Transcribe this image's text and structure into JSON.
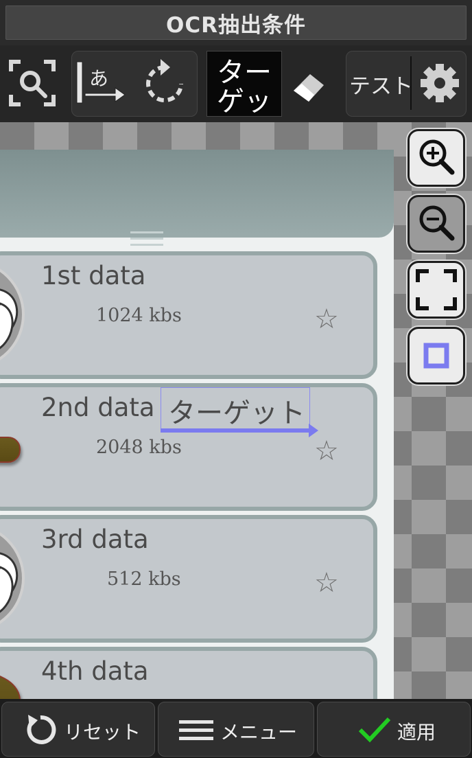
{
  "title": "OCR抽出条件",
  "toolbar": {
    "search_icon": "search-frame-icon",
    "direction_icon": "text-direction-icon",
    "direction_glyph": "あ",
    "rotate_icon": "rotate-icon",
    "target_label_line1": "ター",
    "target_label_line2": "ゲッ",
    "eraser_icon": "eraser-icon",
    "test_label": "テスト",
    "settings_icon": "gear-icon"
  },
  "list": {
    "items": [
      {
        "name": "1st data",
        "size": "1024 kbs"
      },
      {
        "name": "2nd data",
        "size": "2048 kbs"
      },
      {
        "name": "3rd data",
        "size": "512 kbs"
      },
      {
        "name": "4th data",
        "size": ""
      }
    ]
  },
  "ocr_target": {
    "text": "ターゲット",
    "color": "#7b7bef"
  },
  "side_tools": [
    "zoom-in-icon",
    "zoom-out-icon",
    "fit-screen-icon",
    "selection-box-icon"
  ],
  "bottom": {
    "reset_label": "リセット",
    "menu_label": "メニュー",
    "apply_label": "適用",
    "apply_color": "#22cc22"
  }
}
